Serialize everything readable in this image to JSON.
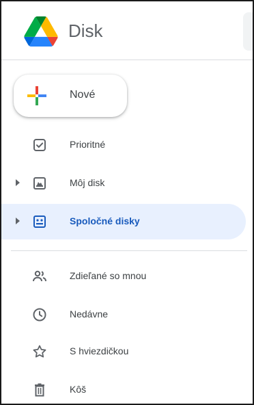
{
  "app": {
    "name": "Disk",
    "logo_icon": "google-drive-logo-icon"
  },
  "new_button": {
    "label": "Nové",
    "icon": "plus-icon"
  },
  "nav": {
    "items": [
      {
        "label": "Prioritné",
        "icon": "check-square-icon",
        "has_expander": false,
        "active": false
      },
      {
        "label": "Môj disk",
        "icon": "my-drive-icon",
        "has_expander": true,
        "active": false
      },
      {
        "label": "Spoločné disky",
        "icon": "shared-drives-icon",
        "has_expander": true,
        "active": true
      },
      {
        "label": "Zdieľané so mnou",
        "icon": "people-icon",
        "has_expander": false,
        "active": false
      },
      {
        "label": "Nedávne",
        "icon": "clock-icon",
        "has_expander": false,
        "active": false
      },
      {
        "label": "S hviezdičkou",
        "icon": "star-outline-icon",
        "has_expander": false,
        "active": false
      },
      {
        "label": "Kôš",
        "icon": "trash-icon",
        "has_expander": false,
        "active": false
      }
    ]
  },
  "colors": {
    "active_bg": "#e8f0fe",
    "active_text": "#185abc",
    "text": "#3c4043",
    "icon": "#5f6368",
    "brand_blue": "#4285f4",
    "brand_red": "#ea4335",
    "brand_yellow": "#fbbc04",
    "brand_green": "#34a853"
  }
}
